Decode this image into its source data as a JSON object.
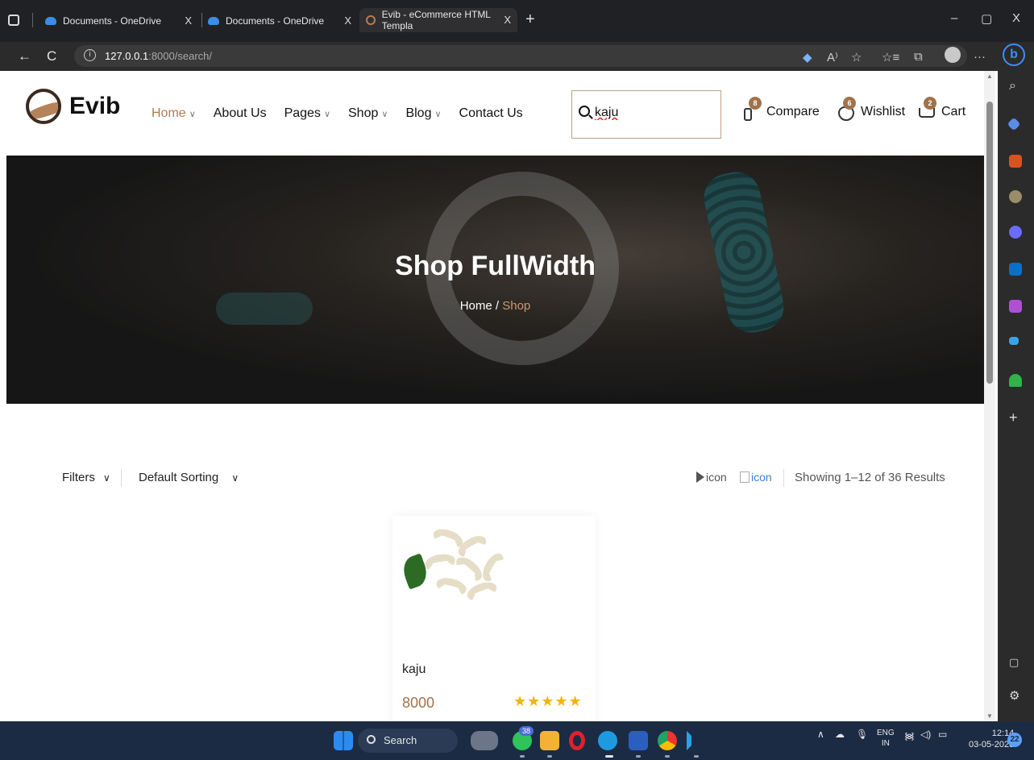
{
  "browser": {
    "tabs": [
      {
        "title": "Documents - OneDrive",
        "close": "X"
      },
      {
        "title": "Documents - OneDrive",
        "close": "X"
      },
      {
        "title": "Evib - eCommerce HTML Templa",
        "close": "X"
      }
    ],
    "new_tab": "+",
    "window_controls": {
      "minimize": "–",
      "restore": "▢",
      "close": "X"
    },
    "url_host": "127.0.0.1",
    "url_path": ":8000/search/",
    "back": "←",
    "reload": "C",
    "info": "i",
    "toolbar_icons": {
      "read_aloud": "A⁾",
      "favorites_add": "☆",
      "favorites": "☆≡",
      "collections": "⧉",
      "more": "···",
      "bing": "b"
    }
  },
  "header": {
    "brand": "Evib",
    "nav": [
      {
        "label": "Home",
        "chevron": "∨"
      },
      {
        "label": "About Us",
        "chevron": ""
      },
      {
        "label": "Pages",
        "chevron": "∨"
      },
      {
        "label": "Shop",
        "chevron": "∨"
      },
      {
        "label": "Blog",
        "chevron": "∨"
      },
      {
        "label": "Contact Us",
        "chevron": ""
      }
    ],
    "search_value": "kaju",
    "actions": [
      {
        "label": "Compare",
        "count": "8"
      },
      {
        "label": "Wishlist",
        "count": "6"
      },
      {
        "label": "Cart",
        "count": "2"
      }
    ]
  },
  "hero": {
    "title": "Shop FullWidth",
    "breadcrumb_home": "Home",
    "breadcrumb_sep": "/",
    "breadcrumb_current": "Shop"
  },
  "toolbar": {
    "filters": "Filters",
    "filters_chevron": "∨",
    "sorting": "Default Sorting",
    "sorting_chevron": "∨",
    "view_icon_1": "icon",
    "view_icon_2": "icon",
    "results": "Showing 1–12 of 36 Results"
  },
  "products": [
    {
      "name": "kaju",
      "price": "8000",
      "rating": 5,
      "stars": "★★★★★"
    }
  ],
  "taskbar": {
    "search": "Search",
    "whatsapp_badge": "38",
    "lang_1": "ENG",
    "lang_2": "IN",
    "time": "12:14",
    "date": "03-05-2023",
    "notifications": "22"
  },
  "colors": {
    "accent": "#a0724c",
    "star": "#f4b400",
    "taskbar": "#1c2b44",
    "chrome": "#202124"
  }
}
